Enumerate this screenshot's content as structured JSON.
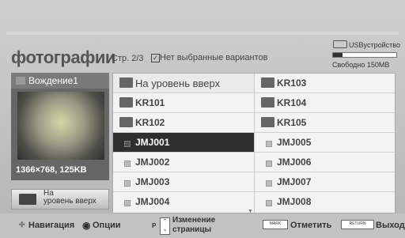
{
  "header": {
    "title": "фотографии",
    "page_info": "Стр. 2/3",
    "selection_status": "Нет выбранные вариантов",
    "usb_label": "USBуcтройство",
    "free_space": "Свободно 150MB"
  },
  "preview": {
    "name": "Вождение1",
    "info": "1366×768, 125KB",
    "up_button_label_line1": "На",
    "up_button_label_line2": "уровень вверх"
  },
  "list": {
    "left": [
      {
        "label": "На уровень вверх",
        "type": "up"
      },
      {
        "label": "KR101",
        "type": "folder"
      },
      {
        "label": "KR102",
        "type": "folder"
      },
      {
        "label": "JMJ001",
        "type": "file",
        "selected": true
      },
      {
        "label": "JMJ002",
        "type": "file"
      },
      {
        "label": "JMJ003",
        "type": "file"
      },
      {
        "label": "JMJ004",
        "type": "file"
      }
    ],
    "right": [
      {
        "label": "KR103",
        "type": "folder"
      },
      {
        "label": "KR104",
        "type": "folder"
      },
      {
        "label": "KR105",
        "type": "folder"
      },
      {
        "label": "JMJ005",
        "type": "file"
      },
      {
        "label": "JMJ006",
        "type": "file"
      },
      {
        "label": "JMJ007",
        "type": "file"
      },
      {
        "label": "JMJ008",
        "type": "file"
      }
    ]
  },
  "footer": {
    "navigation": "Навигация",
    "options": "Опции",
    "page_change_line1": "Изменение",
    "page_change_line2": "страницы",
    "p_key": "P",
    "mark_key": "MARK",
    "mark": "Отметить",
    "return_key": "RETURN",
    "exit": "Выход"
  }
}
